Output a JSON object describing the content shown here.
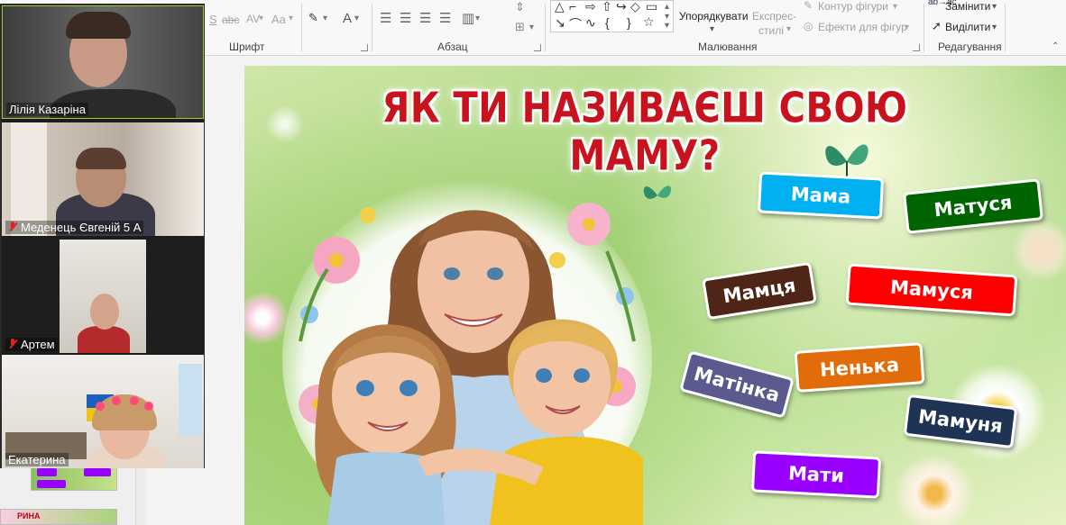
{
  "ribbon": {
    "groups": {
      "font": "Шрифт",
      "paragraph": "Абзац",
      "drawing": "Малювання",
      "editing": "Редагування"
    },
    "font_tools": [
      "S",
      "abc",
      "AV",
      "Aa",
      "A"
    ],
    "drawing": {
      "arrange": "Упорядкувати",
      "quick_styles_line1": "Експрес-",
      "quick_styles_line2": "стилі",
      "shape_outline": "Контур фігури",
      "shape_effects": "Ефекти для фігур"
    },
    "editing": {
      "replace": "Замінити",
      "select": "Виділити"
    }
  },
  "participants": [
    {
      "name": "Лілія Казаріна",
      "muted": false
    },
    {
      "name": "Меденець Євгеній 5 А",
      "muted": true
    },
    {
      "name": "Артем",
      "muted": true
    },
    {
      "name": "Екатерина",
      "muted": false
    }
  ],
  "thumb_strip": {
    "thumb2_text": "РИНА"
  },
  "slide": {
    "title": "ЯК ТИ НАЗИВАЄШ СВОЮ МАМУ?",
    "cards": [
      {
        "label": "Мама",
        "color": "#00b0f0"
      },
      {
        "label": "Матуся",
        "color": "#006400"
      },
      {
        "label": "Мамця",
        "color": "#4f2518"
      },
      {
        "label": "Мамуся",
        "color": "#ff0000"
      },
      {
        "label": "Матінка",
        "color": "#5a5a8e"
      },
      {
        "label": "Ненька",
        "color": "#e26b0a"
      },
      {
        "label": "Мамуня",
        "color": "#1f3355"
      },
      {
        "label": "Мати",
        "color": "#9900ff"
      }
    ]
  }
}
